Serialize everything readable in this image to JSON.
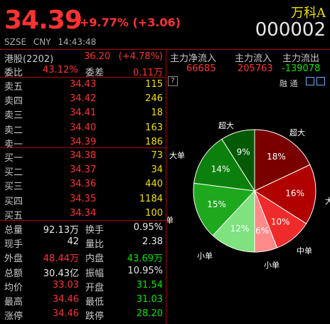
{
  "quote": {
    "price": "34.39",
    "change": "+9.77% (+3.06)",
    "name": "万科A",
    "code": "000002",
    "exchange": "SZSE",
    "currency": "CNY",
    "time": "14:43:48"
  },
  "hk": {
    "label": "港股(2202)",
    "price": "36.20",
    "change": "(+4.78%)"
  },
  "ratio": {
    "label1": "委比",
    "value1": "43.12%",
    "label2": "委差",
    "value2": "0.11万"
  },
  "asks": [
    {
      "label": "卖五",
      "price": "34.43",
      "vol": "115"
    },
    {
      "label": "卖四",
      "price": "34.42",
      "vol": "246"
    },
    {
      "label": "卖三",
      "price": "34.41",
      "vol": "18"
    },
    {
      "label": "卖二",
      "price": "34.40",
      "vol": "163"
    },
    {
      "label": "卖一",
      "price": "34.39",
      "vol": "186"
    }
  ],
  "bids": [
    {
      "label": "买一",
      "price": "34.38",
      "vol": "73"
    },
    {
      "label": "买二",
      "price": "34.37",
      "vol": "34"
    },
    {
      "label": "买三",
      "price": "34.36",
      "vol": "440"
    },
    {
      "label": "买四",
      "price": "34.35",
      "vol": "1184"
    },
    {
      "label": "买五",
      "price": "34.34",
      "vol": "100"
    }
  ],
  "stats": [
    {
      "l1": "总量",
      "v1": "92.13万",
      "l2": "换手",
      "v2": "0.95%",
      "c1": "white",
      "c2": "white"
    },
    {
      "l1": "现手",
      "v1": "42",
      "l2": "量比",
      "v2": "2.38",
      "c1": "white",
      "c2": "white"
    },
    {
      "l1": "外盘",
      "v1": "48.44万",
      "l2": "内盘",
      "v2": "43.69万",
      "c1": "red",
      "c2": "green"
    },
    {
      "l1": "总额",
      "v1": "30.43亿",
      "l2": "振幅",
      "v2": "10.95%",
      "c1": "white",
      "c2": "white"
    },
    {
      "l1": "均价",
      "v1": "33.03",
      "l2": "开盘",
      "v2": "31.54",
      "c1": "red",
      "c2": "green"
    },
    {
      "l1": "最高",
      "v1": "34.46",
      "l2": "最低",
      "v2": "31.03",
      "c1": "red",
      "c2": "green"
    },
    {
      "l1": "涨停",
      "v1": "34.46",
      "l2": "跌停",
      "v2": "28.20",
      "c1": "red",
      "c2": "green"
    }
  ],
  "flow": {
    "headers": [
      "主力净流入",
      "主力流入",
      "主力流出"
    ],
    "values": [
      "66685",
      "205763",
      "-139078"
    ],
    "icons_text": "融 通",
    "help": "?"
  },
  "chart_data": {
    "type": "pie",
    "slices": [
      {
        "label": "超大",
        "value": 18,
        "color": "#7a0000"
      },
      {
        "label": "大单",
        "value": 16,
        "color": "#b00000"
      },
      {
        "label": "中单",
        "value": 10,
        "color": "#ee2a2a"
      },
      {
        "label": "小单",
        "value": 6,
        "color": "#ff8a8a"
      },
      {
        "label": "小单",
        "value": 12,
        "color": "#7ee27e"
      },
      {
        "label": "中单",
        "value": 15,
        "color": "#1ea81e"
      },
      {
        "label": "大单",
        "value": 14,
        "color": "#0c800c"
      },
      {
        "label": "超大",
        "value": 9,
        "color": "#045a04"
      }
    ]
  }
}
